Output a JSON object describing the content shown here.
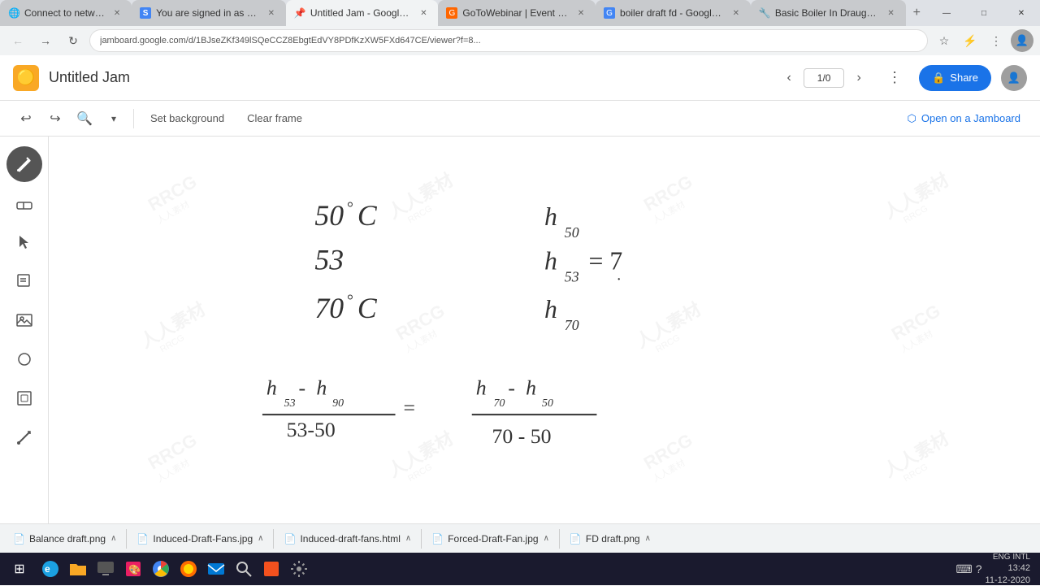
{
  "browser": {
    "tabs": [
      {
        "id": "tab1",
        "label": "Connect to network",
        "favicon": "🌐",
        "active": false
      },
      {
        "id": "tab2",
        "label": "You are signed in as m...",
        "favicon": "S",
        "active": false
      },
      {
        "id": "tab3",
        "label": "Untitled Jam - Google ...",
        "favicon": "📌",
        "active": true
      },
      {
        "id": "tab4",
        "label": "GoToWebinar | Event D...",
        "favicon": "G",
        "active": false
      },
      {
        "id": "tab5",
        "label": "boiler draft fd - Google ...",
        "favicon": "G",
        "active": false
      },
      {
        "id": "tab6",
        "label": "Basic Boiler In Draught...",
        "favicon": "🔧",
        "active": false
      }
    ],
    "url": "jamboard.google.com/d/1BJseZKf349lSQeCCZ8EbgtEdVY8PDfKzXW5FXd647CE/viewer?f=8...",
    "window_controls": {
      "minimize": "—",
      "maximize": "□",
      "close": "✕"
    }
  },
  "app": {
    "logo": "🟡",
    "title": "Untitled Jam",
    "page_indicator": "1/0",
    "share_label": "Share",
    "open_jamboard_label": "Open on a Jamboard"
  },
  "toolbar": {
    "undo_label": "↩",
    "redo_label": "↪",
    "zoom_label": "🔍",
    "more_label": "▾",
    "set_background_label": "Set background",
    "clear_frame_label": "Clear frame"
  },
  "sidebar_tools": [
    {
      "id": "pen",
      "icon": "✏️",
      "label": "Pen",
      "active": true
    },
    {
      "id": "eraser",
      "icon": "◻",
      "label": "Eraser",
      "active": false
    },
    {
      "id": "select",
      "icon": "↖",
      "label": "Select",
      "active": false
    },
    {
      "id": "sticky",
      "icon": "📝",
      "label": "Sticky note",
      "active": false
    },
    {
      "id": "image",
      "icon": "🖼",
      "label": "Image",
      "active": false
    },
    {
      "id": "shape",
      "icon": "○",
      "label": "Shape",
      "active": false
    },
    {
      "id": "frame",
      "icon": "⊞",
      "label": "Frame",
      "active": false
    },
    {
      "id": "laser",
      "icon": "⚡",
      "label": "Laser",
      "active": false
    }
  ],
  "watermarks": [
    "RRCG",
    "人人素材",
    "RRCG",
    "人人素材",
    "人人素材",
    "RRCG",
    "人人素材",
    "RRCG",
    "RRCG",
    "人人素材",
    "RRCG",
    "人人素材"
  ],
  "downloads": [
    {
      "icon": "📄",
      "label": "Balance draft.png",
      "color": "#f4b400"
    },
    {
      "icon": "📄",
      "label": "Induced-Draft-Fans.jpg",
      "color": "#4285f4"
    },
    {
      "icon": "📄",
      "label": "Induced-draft-fans.html",
      "color": "#34a853"
    },
    {
      "icon": "📄",
      "label": "Forced-Draft-Fan.jpg",
      "color": "#4285f4"
    },
    {
      "icon": "📄",
      "label": "FD draft.png",
      "color": "#f4b400"
    }
  ],
  "taskbar": {
    "start_icon": "⊞",
    "apps": [
      "🌐",
      "📁",
      "💻",
      "🎨",
      "🔵",
      "🦊",
      "✉",
      "🔍",
      "📊",
      "⚙"
    ],
    "tray": {
      "keyboard": "⌨",
      "help": "?",
      "lang": "ENG INTL",
      "time": "13:42",
      "date": "11-12-2020"
    }
  }
}
